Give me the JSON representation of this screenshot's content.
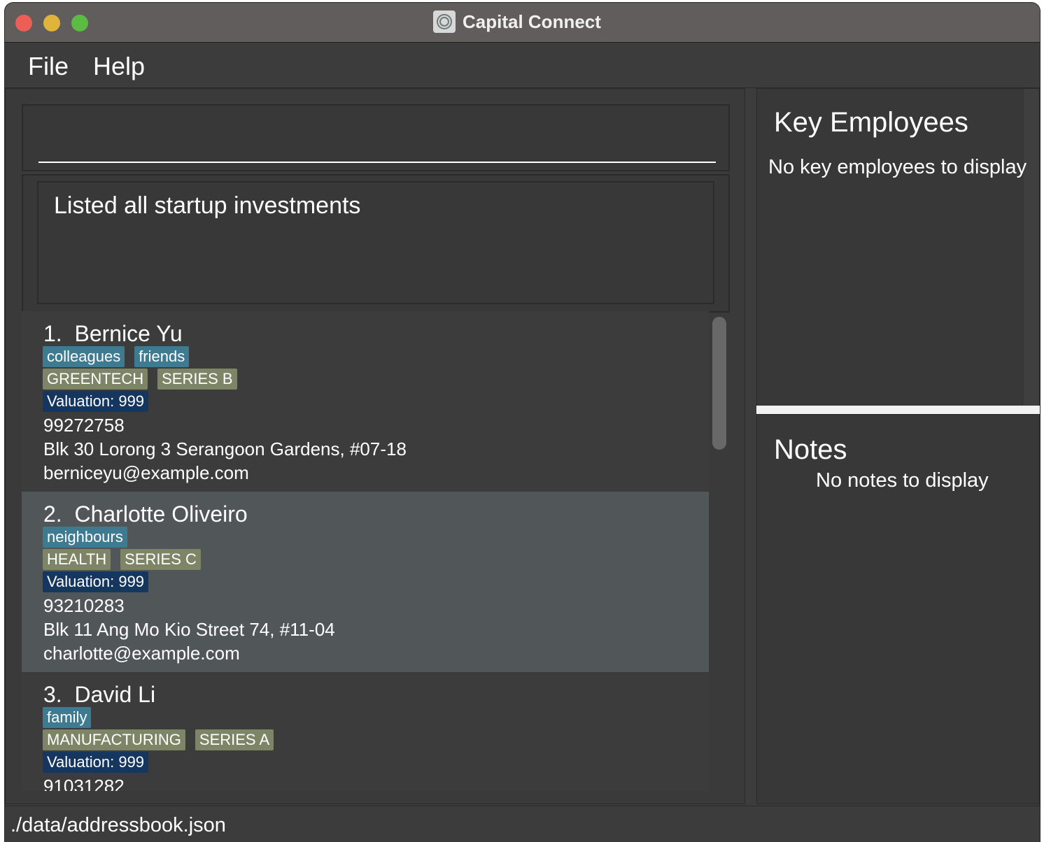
{
  "window": {
    "title": "Capital Connect"
  },
  "menu": {
    "file": "File",
    "help": "Help"
  },
  "command": {
    "value": "",
    "placeholder": ""
  },
  "result": {
    "message": "Listed all startup investments"
  },
  "list": {
    "selected_index": 1,
    "items": [
      {
        "index": "1.",
        "name": "Bernice Yu",
        "tags": [
          "colleagues",
          "friends"
        ],
        "industry": "GREENTECH",
        "funding_stage": "SERIES B",
        "valuation": "Valuation: 999",
        "phone": "99272758",
        "address": "Blk 30 Lorong 3 Serangoon Gardens, #07-18",
        "email": "berniceyu@example.com"
      },
      {
        "index": "2.",
        "name": "Charlotte Oliveiro",
        "tags": [
          "neighbours"
        ],
        "industry": "HEALTH",
        "funding_stage": "SERIES C",
        "valuation": "Valuation: 999",
        "phone": "93210283",
        "address": "Blk 11 Ang Mo Kio Street 74, #11-04",
        "email": "charlotte@example.com"
      },
      {
        "index": "3.",
        "name": "David Li",
        "tags": [
          "family"
        ],
        "industry": "MANUFACTURING",
        "funding_stage": "SERIES A",
        "valuation": "Valuation: 999",
        "phone": "91031282",
        "address": "",
        "email": ""
      }
    ]
  },
  "key_employees": {
    "title": "Key Employees",
    "empty_text": "No key employees to display"
  },
  "notes": {
    "title": "Notes",
    "empty_text": "No notes to display"
  },
  "status": {
    "file_path": "./data/addressbook.json"
  },
  "colors": {
    "tag_blue": "#3e7b91",
    "tag_olive": "#7e8466",
    "tag_navy": "#15375f",
    "selected_row": "#515658"
  }
}
